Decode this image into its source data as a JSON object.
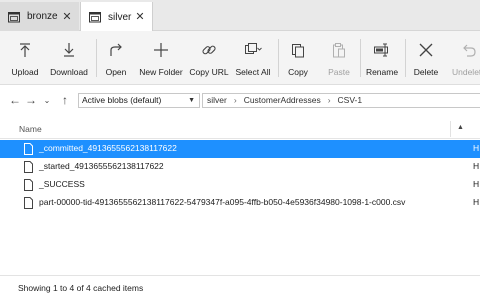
{
  "tabs": [
    {
      "label": "bronze",
      "icon": "folder-icon"
    },
    {
      "label": "silver",
      "icon": "folder-icon"
    }
  ],
  "toolbar": {
    "upload": "Upload",
    "download": "Download",
    "open": "Open",
    "new_folder": "New Folder",
    "copy_url": "Copy URL",
    "select_all": "Select All",
    "copy": "Copy",
    "paste": "Paste",
    "rename": "Rename",
    "delete": "Delete",
    "undelete": "Undelete"
  },
  "address": {
    "view_mode": "Active blobs (default)",
    "crumbs": [
      "silver",
      "CustomerAddresses",
      "CSV-1"
    ]
  },
  "list": {
    "column_name": "Name",
    "rows": [
      {
        "name": "_committed_4913655562138117622",
        "type": "H",
        "selected": true
      },
      {
        "name": "_started_4913655562138117622",
        "type": "H",
        "selected": false
      },
      {
        "name": "_SUCCESS",
        "type": "H",
        "selected": false
      },
      {
        "name": "part-00000-tid-4913655562138117622-5479347f-a095-4ffb-b050-4e5936f34980-1098-1-c000.csv",
        "type": "H",
        "selected": false
      }
    ]
  },
  "status": "Showing 1 to 4 of 4 cached items",
  "colors": {
    "selection": "#1e90ff",
    "toolbar_bg": "#f4f4f4",
    "tab_bg": "#dcdcdc"
  }
}
